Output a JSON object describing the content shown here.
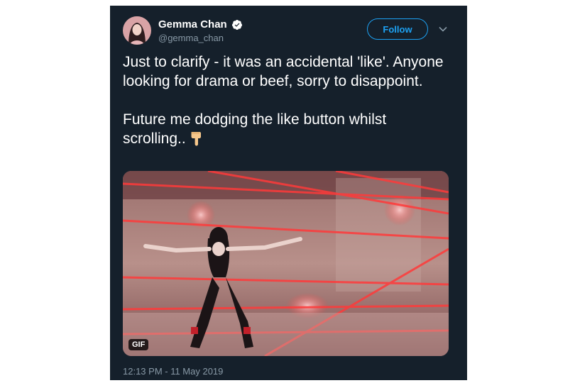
{
  "user": {
    "name": "Gemma Chan",
    "handle": "@gemma_chan",
    "verified_icon": "verified-badge-icon"
  },
  "actions": {
    "follow_label": "Follow",
    "more_icon": "chevron-down-icon"
  },
  "tweet": {
    "paragraph1": "Just to clarify - it was an accidental 'like'. Anyone looking for drama or beef, sorry to disappoint.",
    "paragraph2": "Future me dodging the like button whilst scrolling..",
    "emoji": "backhand-index-pointing-down"
  },
  "media": {
    "badge": "GIF"
  },
  "timestamp": "12:13 PM - 11 May 2019",
  "colors": {
    "background": "#15202b",
    "accent": "#1da1f2",
    "muted": "#8899a6",
    "text": "#ffffff"
  }
}
